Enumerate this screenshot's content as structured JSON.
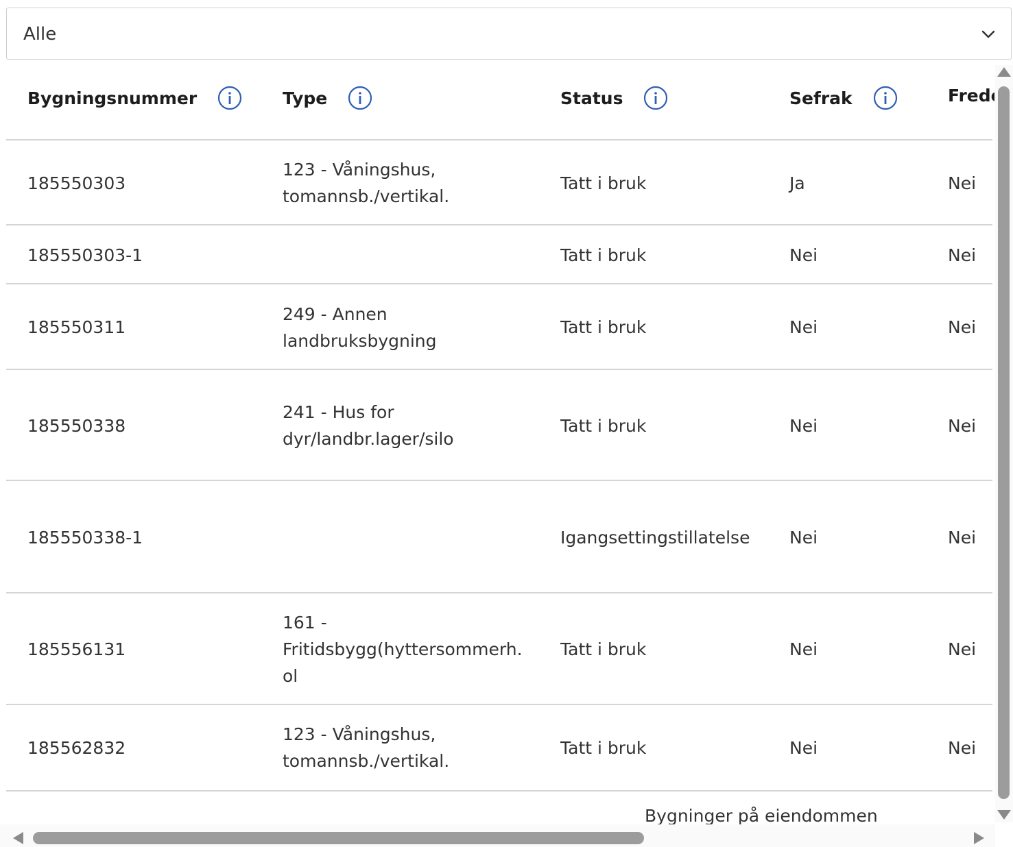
{
  "filter": {
    "selected": "Alle"
  },
  "table": {
    "headers": [
      {
        "label": "Bygningsnummer"
      },
      {
        "label": "Type"
      },
      {
        "label": "Status"
      },
      {
        "label": "Sefrak"
      },
      {
        "label": "Frede"
      }
    ],
    "rows": [
      {
        "bygningsnummer": "185550303",
        "type": "123 - Våningshus, tomannsb./vertikal.",
        "status": "Tatt i bruk",
        "sefrak": "Ja",
        "fredet": "Nei"
      },
      {
        "bygningsnummer": "185550303-1",
        "type": "",
        "status": "Tatt i bruk",
        "sefrak": "Nei",
        "fredet": "Nei"
      },
      {
        "bygningsnummer": "185550311",
        "type": "249 - Annen landbruksbygning",
        "status": "Tatt i bruk",
        "sefrak": "Nei",
        "fredet": "Nei"
      },
      {
        "bygningsnummer": "185550338",
        "type": "241 - Hus for dyr/landbr.lager/silo",
        "status": "Tatt i bruk",
        "sefrak": "Nei",
        "fredet": "Nei"
      },
      {
        "bygningsnummer": "185550338-1",
        "type": "",
        "status": "Igangsettingstillatelse",
        "sefrak": "Nei",
        "fredet": "Nei"
      },
      {
        "bygningsnummer": "185556131",
        "type": "161 - Fritidsbygg(hyttersommerh. ol",
        "status": "Tatt i bruk",
        "sefrak": "Nei",
        "fredet": "Nei"
      },
      {
        "bygningsnummer": "185562832",
        "type": "123 - Våningshus, tomannsb./vertikal.",
        "status": "Tatt i bruk",
        "sefrak": "Nei",
        "fredet": "Nei"
      }
    ],
    "caption": "Bygninger på eiendommen"
  },
  "icons": {
    "info": "info-circle-icon",
    "dropdown": "chevron-down-icon"
  },
  "colors": {
    "info_icon": "#2f5fb3",
    "divider": "#d4d4d4",
    "scrollbar": "#9c9c9c"
  }
}
